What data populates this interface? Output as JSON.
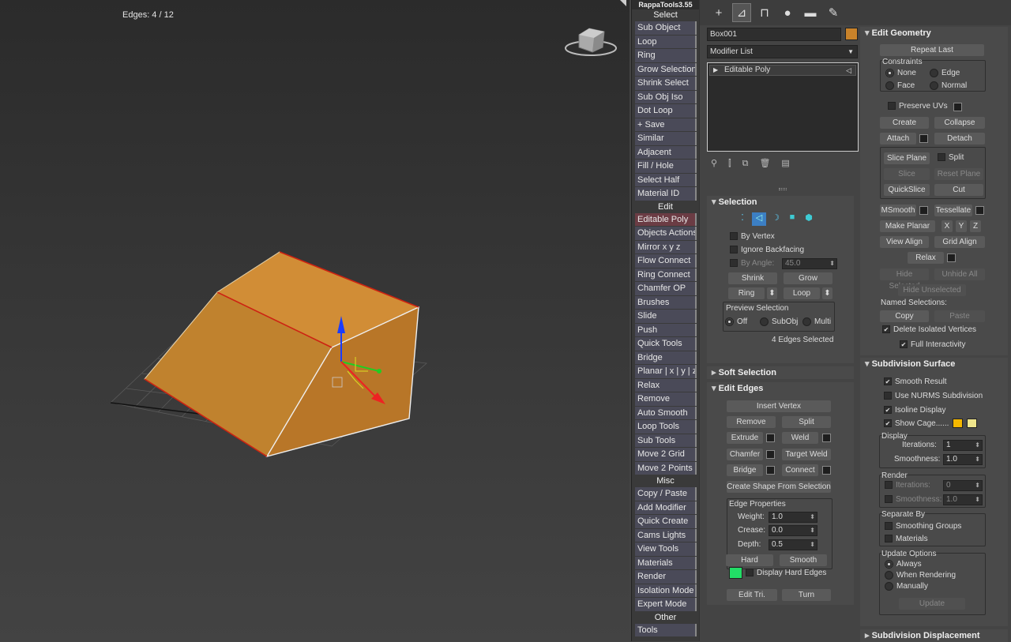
{
  "viewport": {
    "edge_count": "Edges: 4 / 12"
  },
  "rappa": {
    "title": "RappaTools3.55",
    "sections": {
      "select": "Select",
      "edit": "Edit",
      "misc": "Misc",
      "other": "Other"
    },
    "select_items": [
      "Sub Object",
      "Loop",
      "Ring",
      "Grow Selection",
      "Shrink Select",
      "Sub Obj Iso",
      "Dot Loop",
      "+ Save",
      "Similar",
      "Adjacent",
      "Fill / Hole",
      "Select Half",
      "Material ID"
    ],
    "edit_items": [
      "Editable Poly",
      "Objects Actions",
      "Mirror    x   y   z",
      "Flow Connect",
      "Ring Connect",
      "Chamfer OP",
      "Brushes",
      "Slide",
      "Push",
      "Quick Tools",
      "Bridge",
      "Planar | x | y | z",
      "Relax",
      "Remove",
      "Auto Smooth",
      "Loop Tools",
      "Sub Tools",
      "Move 2 Grid",
      "Move 2 Points"
    ],
    "misc_items": [
      "Copy / Paste",
      "Add Modifier",
      "Quick Create",
      "Cams Lights",
      "View Tools",
      "Materials",
      "Render",
      "Isolation Mode",
      "Expert Mode"
    ],
    "other_items": [
      "Tools"
    ]
  },
  "cmd": {
    "tabs": [
      "create-icon",
      "modify-icon",
      "hierarchy-icon",
      "motion-icon",
      "display-icon",
      "utilities-icon"
    ],
    "object_name": "Box001",
    "object_color": "#c8822a",
    "modifier_list": "Modifier List",
    "stack_item": "Editable Poly",
    "selection": {
      "title": "Selection",
      "by_vertex": "By Vertex",
      "ignore_backfacing": "Ignore Backfacing",
      "by_angle": "By Angle:",
      "angle_value": "45.0",
      "shrink": "Shrink",
      "grow": "Grow",
      "ring": "Ring",
      "loop": "Loop",
      "preview_selection": "Preview Selection",
      "off": "Off",
      "subobj": "SubObj",
      "multi": "Multi",
      "status": "4 Edges Selected"
    },
    "soft_selection": {
      "title": "Soft Selection"
    },
    "edit_edges": {
      "title": "Edit Edges",
      "insert_vertex": "Insert Vertex",
      "remove": "Remove",
      "split": "Split",
      "extrude": "Extrude",
      "weld": "Weld",
      "chamfer": "Chamfer",
      "target_weld": "Target Weld",
      "bridge": "Bridge",
      "connect": "Connect",
      "create_shape": "Create Shape From Selection",
      "edge_properties": "Edge Properties",
      "weight_label": "Weight:",
      "weight": "1.0",
      "crease_label": "Crease:",
      "crease": "0.0",
      "depth_label": "Depth:",
      "depth": "0.5",
      "hard": "Hard",
      "smooth": "Smooth",
      "display_hard_edges": "Display Hard Edges",
      "hard_edge_color": "#22dd66",
      "edit_tri": "Edit Tri.",
      "turn": "Turn"
    },
    "edit_geometry": {
      "title": "Edit Geometry",
      "repeat_last": "Repeat Last",
      "constraints": "Constraints",
      "none": "None",
      "edge": "Edge",
      "face": "Face",
      "normal": "Normal",
      "preserve_uvs": "Preserve UVs",
      "create": "Create",
      "collapse": "Collapse",
      "attach": "Attach",
      "detach": "Detach",
      "slice_plane": "Slice Plane",
      "split": "Split",
      "slice": "Slice",
      "reset_plane": "Reset Plane",
      "quickslice": "QuickSlice",
      "cut": "Cut",
      "msmooth": "MSmooth",
      "tessellate": "Tessellate",
      "make_planar": "Make Planar",
      "x": "X",
      "y": "Y",
      "z": "Z",
      "view_align": "View Align",
      "grid_align": "Grid Align",
      "relax": "Relax",
      "hide_selected": "Hide Selected",
      "unhide_all": "Unhide All",
      "hide_unselected": "Hide Unselected",
      "named_selections": "Named Selections:",
      "copy": "Copy",
      "paste": "Paste",
      "delete_isolated": "Delete Isolated Vertices",
      "full_interactivity": "Full Interactivity"
    },
    "subdivision": {
      "title": "Subdivision Surface",
      "smooth_result": "Smooth Result",
      "use_nurms": "Use NURMS Subdivision",
      "isoline_display": "Isoline Display",
      "show_cage": "Show Cage......",
      "cage_color1": "#f5b800",
      "cage_color2": "#f0e68c",
      "display": "Display",
      "iterations_label": "Iterations:",
      "iterations": "1",
      "smoothness_label": "Smoothness:",
      "smoothness": "1.0",
      "render": "Render",
      "r_iterations": "0",
      "r_smoothness": "1.0",
      "separate_by": "Separate By",
      "smoothing_groups": "Smoothing Groups",
      "materials": "Materials",
      "update_options": "Update Options",
      "always": "Always",
      "when_rendering": "When Rendering",
      "manually": "Manually",
      "update": "Update"
    },
    "subdivision_displacement": {
      "title": "Subdivision Displacement"
    }
  }
}
